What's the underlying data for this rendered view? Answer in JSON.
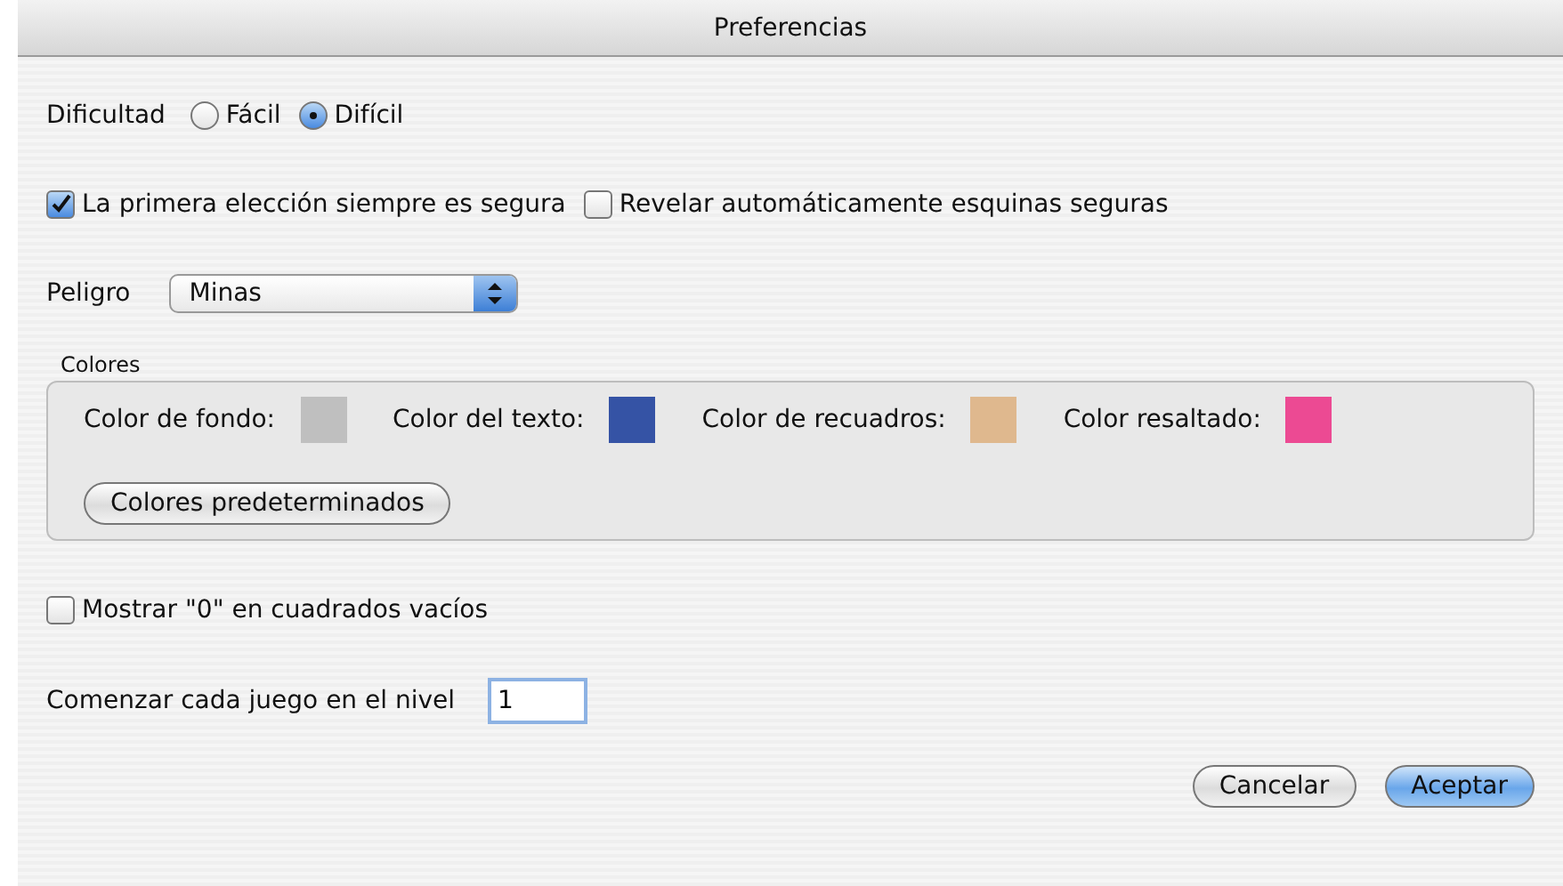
{
  "window": {
    "title": "Preferencias"
  },
  "difficulty": {
    "label": "Dificultad",
    "options": [
      {
        "label": "Fácil",
        "selected": false
      },
      {
        "label": "Difícil",
        "selected": true
      }
    ]
  },
  "options": [
    {
      "label": "La primera elección siempre es segura",
      "checked": true
    },
    {
      "label": "Revelar automáticamente esquinas seguras",
      "checked": false
    }
  ],
  "danger": {
    "label": "Peligro",
    "value": "Minas"
  },
  "colors": {
    "title": "Colores",
    "items": [
      {
        "label": "Color de fondo:",
        "color": "#bfbfbf"
      },
      {
        "label": "Color del texto:",
        "color": "#3553a5"
      },
      {
        "label": "Color de recuadros:",
        "color": "#dfb88e"
      },
      {
        "label": "Color resaltado:",
        "color": "#ec4a93"
      }
    ],
    "reset_button": "Colores predeterminados"
  },
  "show_zero": {
    "label": "Mostrar \"0\" en cuadrados vacíos",
    "checked": false
  },
  "start_level": {
    "label": "Comenzar cada juego en el nivel",
    "value": "1"
  },
  "buttons": [
    {
      "label": "Cancelar",
      "kind": "normal"
    },
    {
      "label": "Aceptar",
      "kind": "default"
    }
  ]
}
